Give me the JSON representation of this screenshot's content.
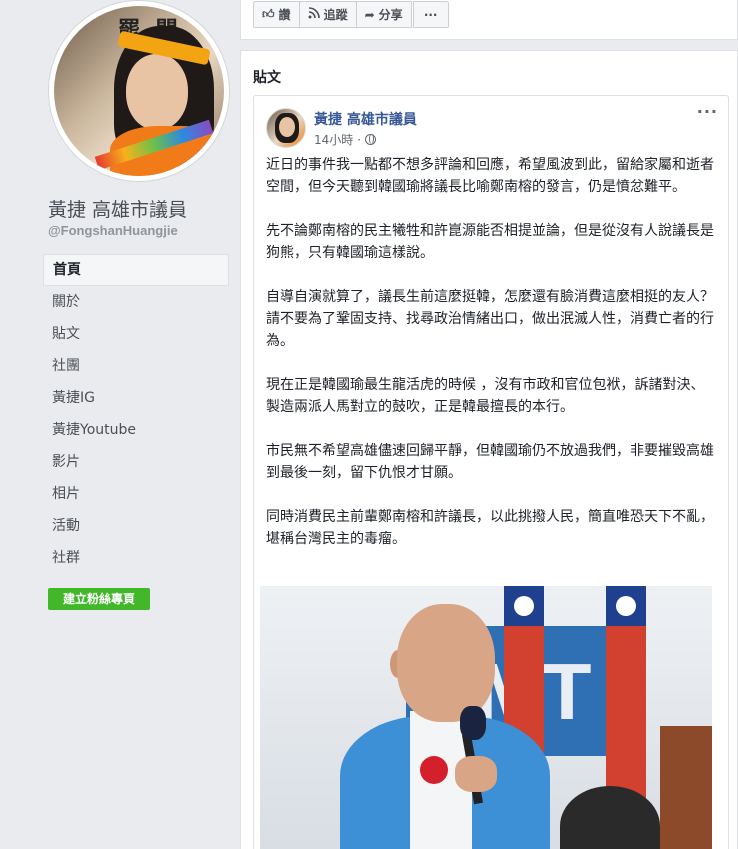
{
  "page": {
    "name": "黃捷 高雄市議員",
    "handle": "@FongshanHuangjie"
  },
  "nav": {
    "items": [
      {
        "label": "首頁",
        "active": true
      },
      {
        "label": "關於"
      },
      {
        "label": "貼文"
      },
      {
        "label": "社團"
      },
      {
        "label": "黃捷IG"
      },
      {
        "label": "黃捷Youtube"
      },
      {
        "label": "影片"
      },
      {
        "label": "相片"
      },
      {
        "label": "活動"
      },
      {
        "label": "社群"
      }
    ],
    "create_button": "建立粉絲專頁"
  },
  "actions": {
    "like": "讚",
    "follow": "追蹤",
    "share": "分享",
    "more": "···"
  },
  "posts_section": {
    "title": "貼文"
  },
  "post": {
    "author": "黃捷 高雄市議員",
    "time": "14小時",
    "menu": "···",
    "paragraphs": [
      "近日的事件我一點都不想多評論和回應，希望風波到此，留給家屬和逝者空間，但今天聽到韓國瑜將議長比喻鄭南榕的發言，仍是憤忿難平。",
      "先不論鄭南榕的民主犧牲和許崑源能否相提並論，但是從沒有人說議長是狗熊，只有韓國瑜這樣說。",
      "自導自演就算了，議長生前這麼挺韓，怎麼還有臉消費這麼相挺的友人？請不要為了鞏固支持、找尋政治情緒出口，做出泯滅人性，消費亡者的行為。",
      "現在正是韓國瑜最生龍活虎的時候 ，沒有市政和官位包袱，訴諸對決、製造兩派人馬對立的鼓吹，正是韓最擅長的本行。",
      "市民無不希望高雄儘速回歸平靜，但韓國瑜仍不放過我們，非要摧毀高雄到最後一刻，留下仇恨才甘願。",
      "同時消費民主前輩鄭南榕和許議長，以此挑撥人民，簡直唯恐天下不亂，堪稱台灣民主的毒瘤。"
    ],
    "photo_text": "MT"
  },
  "colors": {
    "background": "#e9ebee",
    "link": "#385898",
    "create_button": "#42b72a"
  }
}
